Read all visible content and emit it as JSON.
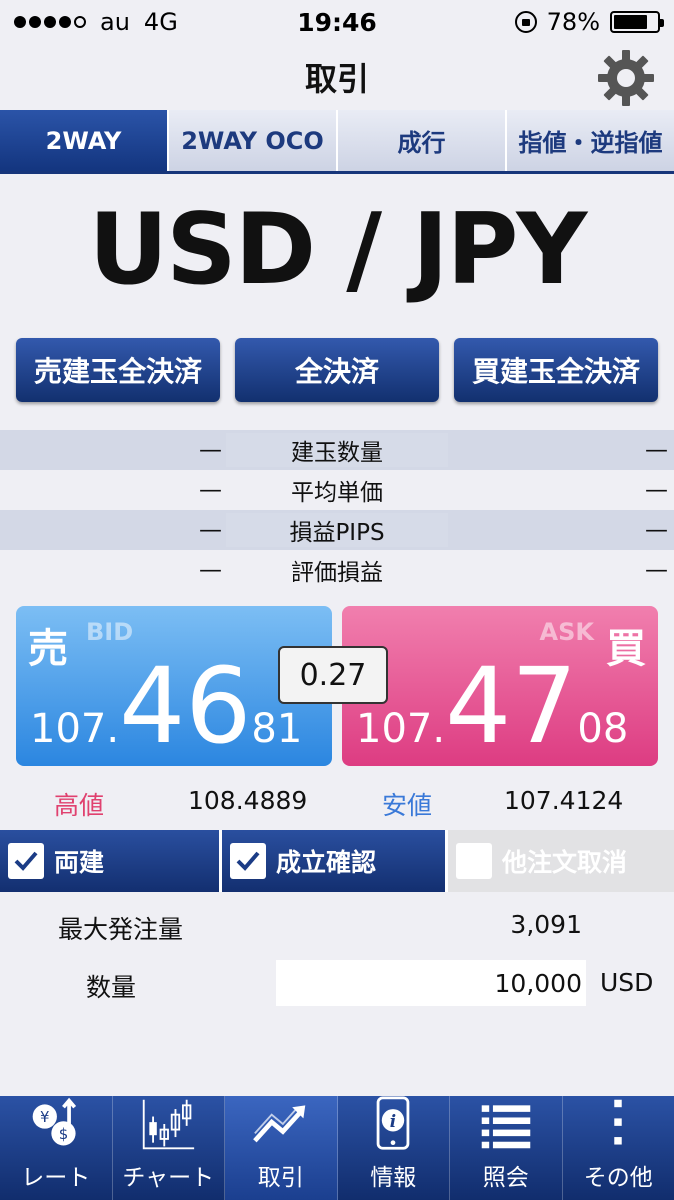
{
  "status": {
    "carrier": "au",
    "network": "4G",
    "time": "19:46",
    "battery": "78%",
    "battery_level": 0.78
  },
  "nav": {
    "title": "取引",
    "icon": "gear-icon"
  },
  "order_tabs": [
    "2WAY",
    "2WAY OCO",
    "成行",
    "指値・逆指値"
  ],
  "pair": "USD / JPY",
  "actions": {
    "sell_close": "売建玉全決済",
    "close_all": "全決済",
    "buy_close": "買建玉全決済"
  },
  "positions": [
    {
      "left": "—",
      "label": "建玉数量",
      "right": "—"
    },
    {
      "left": "—",
      "label": "平均単価",
      "right": "—"
    },
    {
      "left": "—",
      "label": "損益PIPS",
      "right": "—"
    },
    {
      "left": "—",
      "label": "評価損益",
      "right": "—"
    }
  ],
  "bid": {
    "side": "売",
    "label": "BID",
    "prefix": "107.",
    "big": "46",
    "suffix": "81"
  },
  "ask": {
    "side": "買",
    "label": "ASK",
    "prefix": "107.",
    "big": "47",
    "suffix": "08"
  },
  "spread": "0.27",
  "hilo": {
    "high_label": "高値",
    "high": "108.4889",
    "low_label": "安値",
    "low": "107.4124"
  },
  "options": {
    "both": "両建",
    "confirm": "成立確認",
    "cancel_other": "他注文取消"
  },
  "order": {
    "max_label": "最大発注量",
    "max_value": "3,091",
    "qty_label": "数量",
    "qty_value": "10,000",
    "unit": "USD"
  },
  "tabbar": [
    "レート",
    "チャート",
    "取引",
    "情報",
    "照会",
    "その他"
  ],
  "colors": {
    "navy": "#13357f",
    "bid": "#2b86e0",
    "ask": "#dd3c82"
  }
}
